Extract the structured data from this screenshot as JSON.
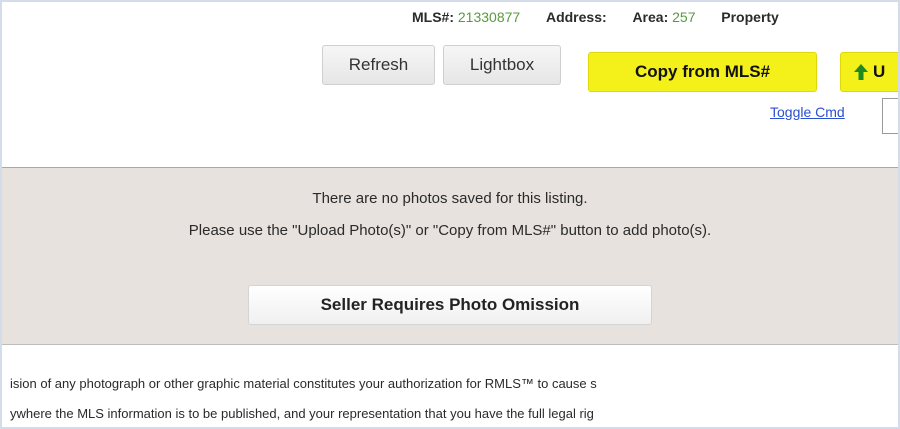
{
  "header": {
    "mls_label": "MLS#:",
    "mls_value": "21330877",
    "address_label": "Address:",
    "area_label": "Area:",
    "area_value": "257",
    "property_label": "Property"
  },
  "toolbar": {
    "refresh_label": "Refresh",
    "lightbox_label": "Lightbox",
    "copy_label": "Copy from MLS#",
    "upload_label": "U",
    "toggle_label": "Toggle Cmd"
  },
  "message": {
    "line1": "There are no photos saved for this listing.",
    "line2": "Please use the \"Upload Photo(s)\" or \"Copy from MLS#\" button to add photo(s).",
    "omission_label": "Seller Requires Photo Omission"
  },
  "disclaimer": {
    "line1": "ision of any photograph or other graphic material constitutes your authorization for RMLS™ to cause s",
    "line2": "ywhere the MLS information is to be published, and your representation that you have the full legal rig"
  },
  "colors": {
    "accent_yellow": "#f4f01a",
    "value_green": "#5a9a3e",
    "link_blue": "#2a4fd0",
    "panel_gray": "#e7e2dd"
  },
  "icons": {
    "upload": "arrow-up-icon"
  }
}
